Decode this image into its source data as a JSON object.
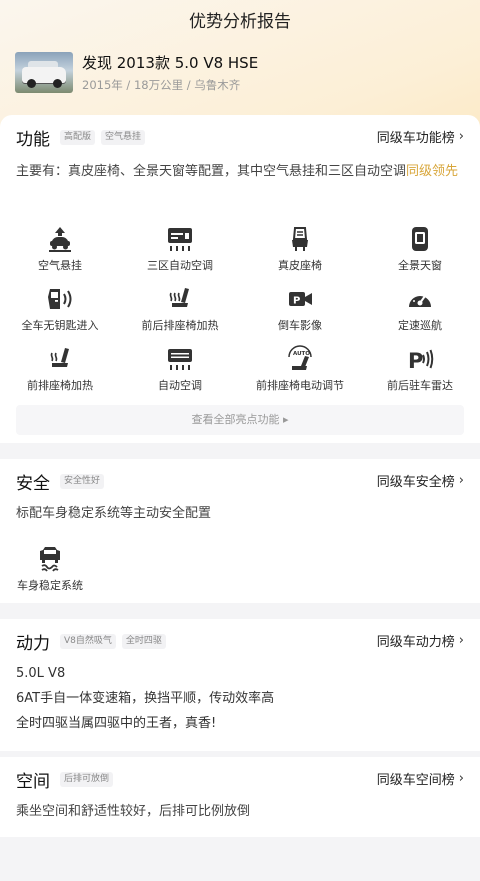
{
  "header": {
    "title": "优势分析报告"
  },
  "car": {
    "name": "发现 2013款 5.0 V8 HSE",
    "meta": "2015年 / 18万公里 / 乌鲁木齐"
  },
  "features": {
    "title": "功能",
    "tags": [
      "高配版",
      "空气悬挂"
    ],
    "rank_label": "同级车功能榜",
    "desc_main": "主要有：真皮座椅、全景天窗等配置，其中空气悬挂和三区自动空调",
    "desc_highlight": "同级领先",
    "items": [
      {
        "label": "空气悬挂",
        "icon": "air-suspension-icon"
      },
      {
        "label": "三区自动空调",
        "icon": "climate-control-icon"
      },
      {
        "label": "真皮座椅",
        "icon": "leather-seat-icon"
      },
      {
        "label": "全景天窗",
        "icon": "panoramic-sunroof-icon"
      },
      {
        "label": "全车无钥匙进入",
        "icon": "keyless-entry-icon"
      },
      {
        "label": "前后排座椅加热",
        "icon": "seat-heating-icon"
      },
      {
        "label": "倒车影像",
        "icon": "parking-camera-icon"
      },
      {
        "label": "定速巡航",
        "icon": "cruise-control-icon"
      },
      {
        "label": "前排座椅加热",
        "icon": "front-seat-heating-icon"
      },
      {
        "label": "自动空调",
        "icon": "auto-ac-icon"
      },
      {
        "label": "前排座椅电动调节",
        "icon": "power-seat-icon"
      },
      {
        "label": "前后驻车雷达",
        "icon": "parking-radar-icon"
      }
    ],
    "more_label": "查看全部亮点功能 ▸"
  },
  "safety": {
    "title": "安全",
    "tags": [
      "安全性好"
    ],
    "rank_label": "同级车安全榜",
    "desc": "标配车身稳定系统等主动安全配置",
    "items": [
      {
        "label": "车身稳定系统",
        "icon": "stability-control-icon"
      }
    ]
  },
  "power": {
    "title": "动力",
    "tags": [
      "V8自然吸气",
      "全时四驱"
    ],
    "rank_label": "同级车动力榜",
    "lines": [
      "5.0L V8",
      "6AT手自一体变速箱，换挡平顺，传动效率高",
      "全时四驱当属四驱中的王者，真香!"
    ]
  },
  "space": {
    "title": "空间",
    "tags": [
      "后排可放倒"
    ],
    "rank_label": "同级车空间榜",
    "desc": "乘坐空间和舒适性较好，后排可比例放倒"
  },
  "colors": {
    "accent": "#d8a63a",
    "hero_start": "#fbf6ee",
    "hero_end": "#fbe3b3"
  }
}
